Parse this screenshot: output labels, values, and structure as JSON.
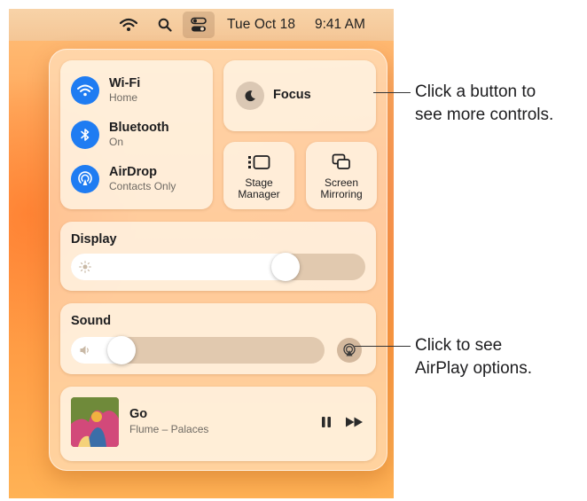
{
  "menubar": {
    "date": "Tue Oct 18",
    "time": "9:41 AM",
    "icons": [
      "wifi-icon",
      "search-icon",
      "control-center-icon"
    ]
  },
  "control_center": {
    "wifi": {
      "title": "Wi-Fi",
      "subtitle": "Home"
    },
    "bluetooth": {
      "title": "Bluetooth",
      "subtitle": "On"
    },
    "airdrop": {
      "title": "AirDrop",
      "subtitle": "Contacts Only"
    },
    "focus": {
      "label": "Focus"
    },
    "stage_manager": {
      "label_line1": "Stage",
      "label_line2": "Manager"
    },
    "screen_mirroring": {
      "label_line1": "Screen",
      "label_line2": "Mirroring"
    },
    "display": {
      "title": "Display",
      "level": 0.73
    },
    "sound": {
      "title": "Sound",
      "level": 0.2
    },
    "now_playing": {
      "title": "Go",
      "artist": "Flume – Palaces"
    }
  },
  "callouts": {
    "buttons": {
      "line1": "Click a button to",
      "line2": "see more controls."
    },
    "airplay": {
      "line1": "Click to see",
      "line2": "AirPlay options."
    }
  },
  "colors": {
    "accent_blue": "#1f7cf2",
    "wallpaper_orange": "#ff9a4a"
  }
}
